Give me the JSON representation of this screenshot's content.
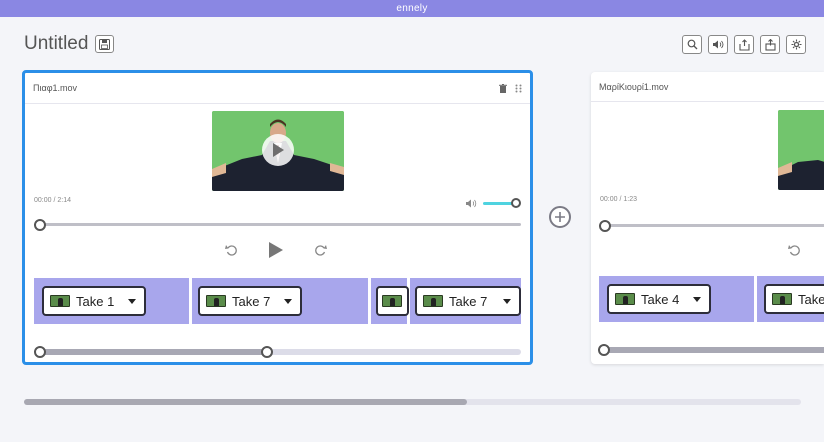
{
  "app": {
    "brand": "ennely"
  },
  "document": {
    "title": "Untitled"
  },
  "toolbar": {
    "icons": [
      "zoom-icon",
      "volume-icon",
      "export-icon",
      "share-icon",
      "settings-icon"
    ]
  },
  "colors": {
    "accent": "#8a87e3",
    "selected": "#2b8fe8",
    "takes": "#a8a6ec",
    "volume": "#4fd3e0"
  },
  "clips": [
    {
      "filename": "Πιαφ1.mov",
      "timecode": "00:00 / 2:14",
      "volume_level": 1.0,
      "playhead": 0.0,
      "takes": [
        "Take 1",
        "Take 7",
        "Take 7"
      ],
      "trim_position": 0.5
    },
    {
      "filename": "ΜαρίΚιουρί1.mov",
      "timecode": "00:00 / 1:23",
      "playhead": 0.0,
      "takes": [
        "Take 4",
        "Take"
      ]
    }
  ],
  "scroll": {
    "horizontal_fraction": 0.57
  }
}
